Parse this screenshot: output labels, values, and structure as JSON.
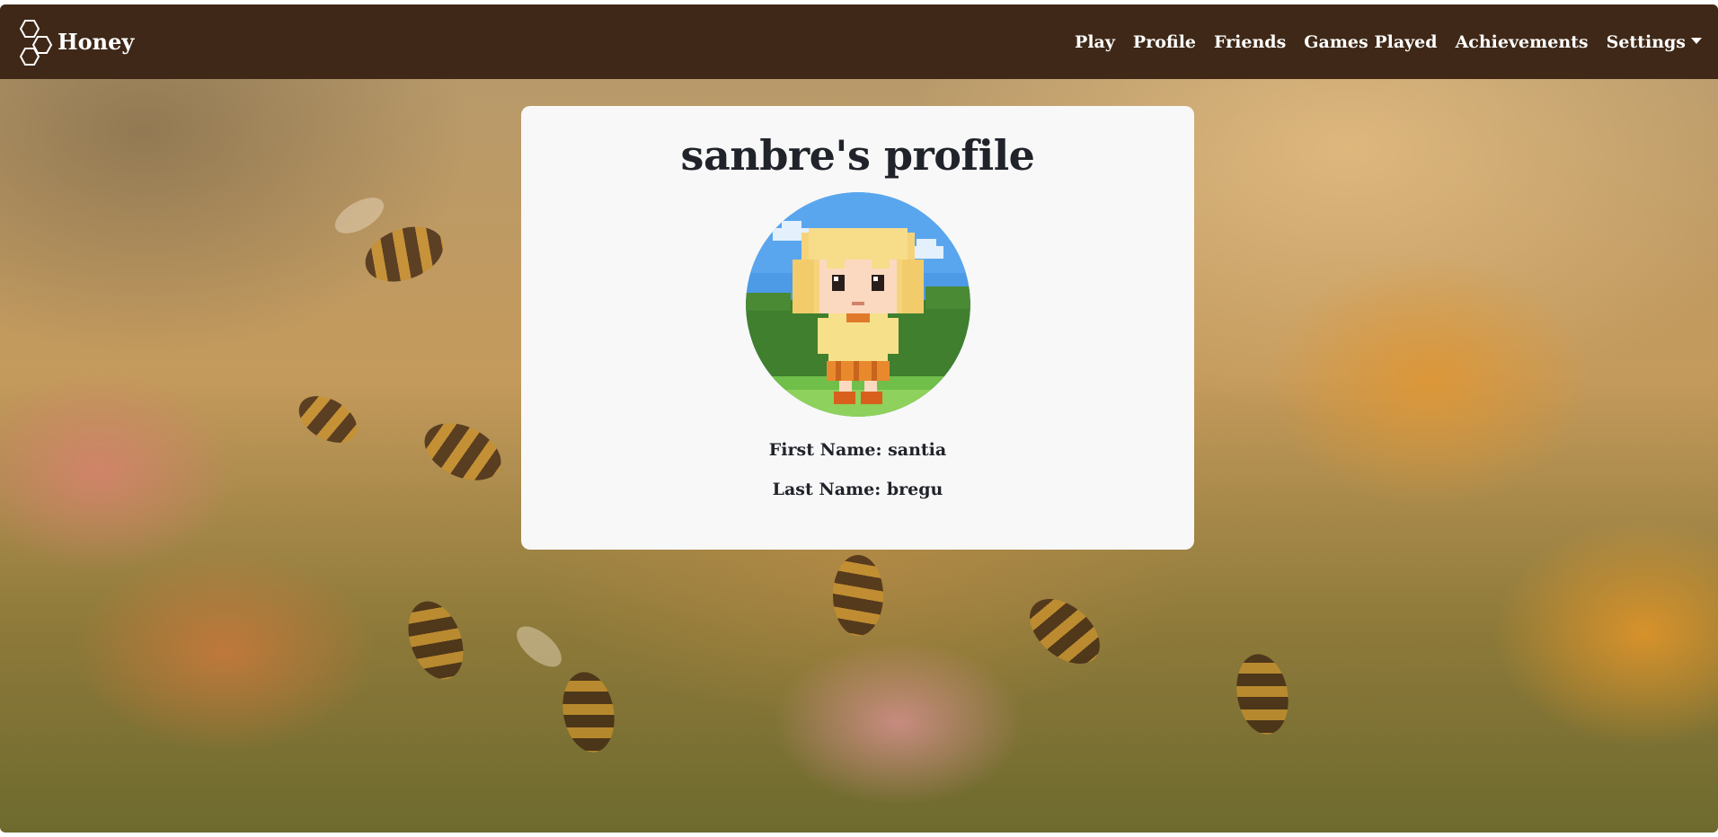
{
  "navbar": {
    "brand": "Honey",
    "links": [
      "Play",
      "Profile",
      "Friends",
      "Games Played",
      "Achievements"
    ],
    "settings": "Settings",
    "background_color": "#3f2817"
  },
  "profile": {
    "title": "sanbre's profile",
    "avatar_icon": "pixel-girl-avatar",
    "first_name_label": "First Name: santia",
    "last_name_label": "Last Name: bregu"
  },
  "icons": {
    "brand_logo": "honeycomb-icon",
    "settings_caret": "caret-down-icon"
  }
}
